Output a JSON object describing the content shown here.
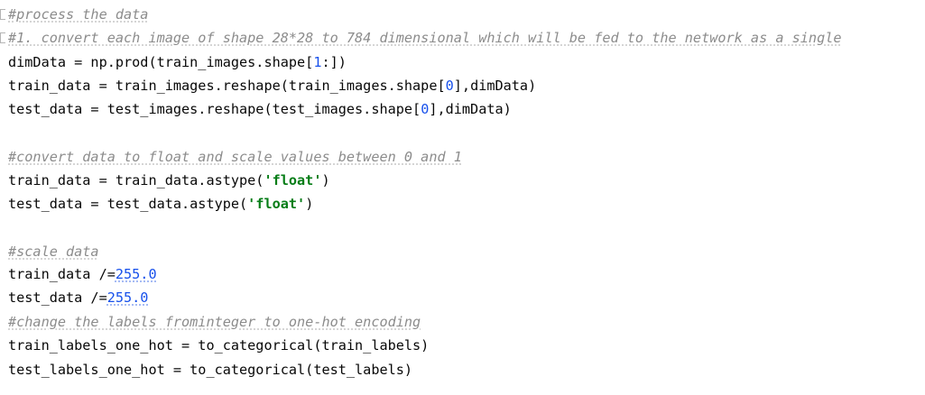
{
  "code": {
    "l1": {
      "comment": "#process the data"
    },
    "l2": {
      "comment": "#1. convert each image of shape 28*28 to 784 dimensional which will be fed to the network as a single"
    },
    "l3": {
      "before": "dimData = np.prod(train_images.shape[",
      "num": "1",
      "after": ":])"
    },
    "l4": {
      "before": "train_data = train_images.reshape(train_images.shape[",
      "num": "0",
      "after": "],dimData)"
    },
    "l5": {
      "before": "test_data = test_images.reshape(test_images.shape[",
      "num": "0",
      "after": "],dimData)"
    },
    "l6": {
      "comment": "#convert data to float and scale values between 0 and 1"
    },
    "l7": {
      "before": "train_data = train_data.astype(",
      "str": "'float'",
      "after": ")"
    },
    "l8": {
      "before": "test_data = test_data.astype(",
      "str": "'float'",
      "after": ")"
    },
    "l9": {
      "comment": "#scale data"
    },
    "l10": {
      "before": "train_data /=",
      "num": "255.0"
    },
    "l11": {
      "before": "test_data /=",
      "num": "255.0"
    },
    "l12": {
      "comment": "#change the labels frominteger to one-hot encoding"
    },
    "l13": {
      "text": "train_labels_one_hot = to_categorical(train_labels)"
    },
    "l14": {
      "text": "test_labels_one_hot = to_categorical(test_labels)"
    }
  },
  "colors": {
    "comment": "#8c8c8c",
    "number": "#1750eb",
    "string": "#067d17",
    "text": "#080808",
    "background": "#ffffff"
  }
}
